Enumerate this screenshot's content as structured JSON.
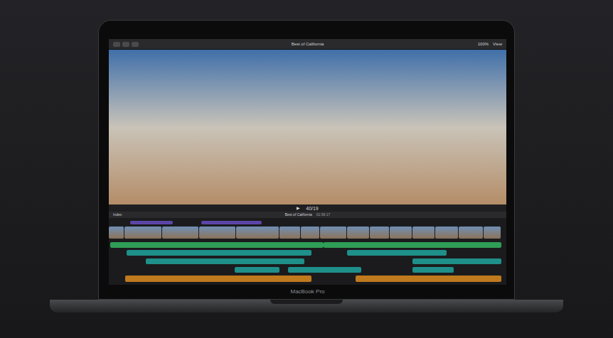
{
  "device": {
    "label": "MacBook Pro"
  },
  "toolbar": {
    "title": "Best of California",
    "zoom": "100%",
    "view": "View"
  },
  "viewer": {
    "play": "▶",
    "timecode": "40/19"
  },
  "timeline": {
    "index": "Index",
    "title": "Best of California",
    "duration": "01:58:17",
    "clips": [
      {
        "kind": "title"
      },
      {
        "kind": "title"
      },
      {
        "kind": "video"
      },
      {
        "kind": "video"
      },
      {
        "kind": "video"
      },
      {
        "kind": "video"
      },
      {
        "kind": "video"
      },
      {
        "kind": "video"
      },
      {
        "kind": "video"
      },
      {
        "kind": "video"
      },
      {
        "kind": "video"
      },
      {
        "kind": "video"
      },
      {
        "kind": "video"
      },
      {
        "kind": "video"
      },
      {
        "kind": "video"
      },
      {
        "kind": "video"
      },
      {
        "kind": "video"
      },
      {
        "kind": "music"
      },
      {
        "kind": "music"
      },
      {
        "kind": "audio"
      },
      {
        "kind": "audio"
      },
      {
        "kind": "audio"
      },
      {
        "kind": "audio"
      },
      {
        "kind": "audio"
      },
      {
        "kind": "audio"
      },
      {
        "kind": "audio"
      },
      {
        "kind": "effects"
      },
      {
        "kind": "effects"
      }
    ]
  }
}
